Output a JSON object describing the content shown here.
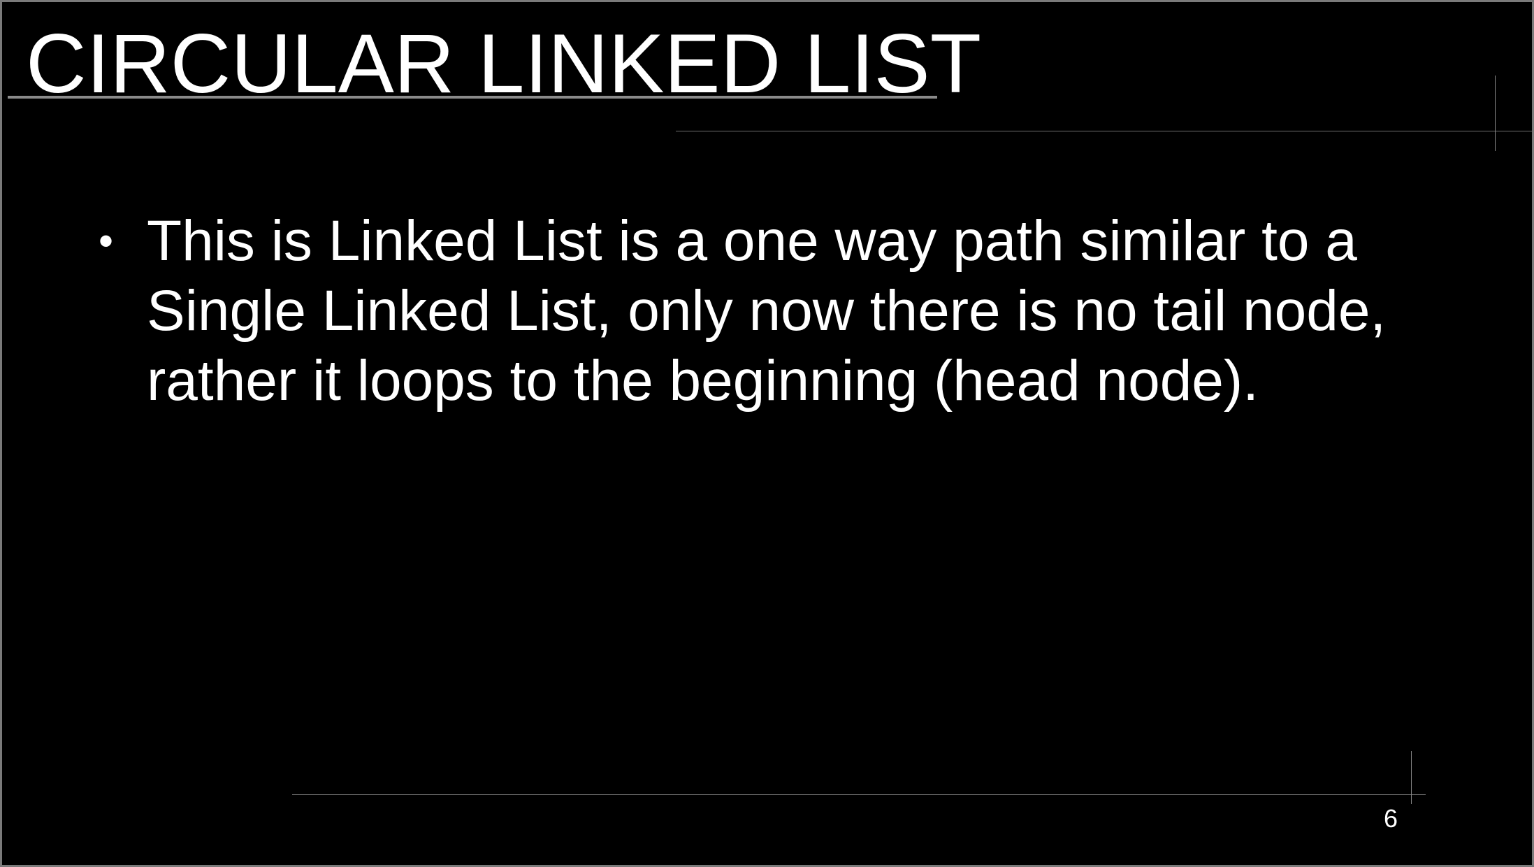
{
  "slide": {
    "title": "CIRCULAR LINKED LIST",
    "bullets": [
      "This is Linked List is a one way path similar to a Single Linked List, only now there is no tail node, rather it loops to the beginning (head node)."
    ],
    "page_number": "6"
  },
  "colors": {
    "background": "#000000",
    "text": "#ffffff",
    "rules": "#6e6e6e"
  }
}
